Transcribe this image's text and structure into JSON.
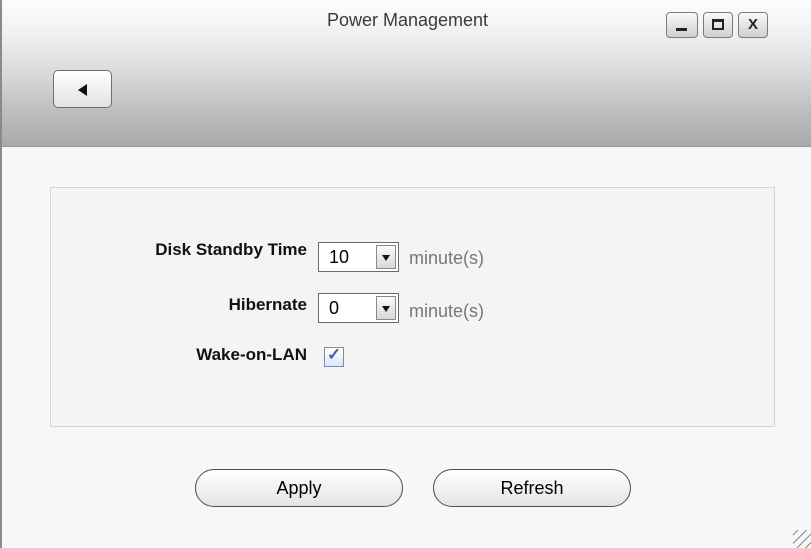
{
  "window": {
    "title": "Power Management",
    "controls": [
      "minimize-icon",
      "maximize-icon",
      "close-icon"
    ],
    "close_glyph": "X"
  },
  "toolbar": {
    "back_icon": "left-arrow-icon"
  },
  "form": {
    "disk_standby": {
      "label": "Disk Standby Time",
      "value": "10",
      "unit": "minute(s)"
    },
    "hibernate": {
      "label": "Hibernate",
      "value": "0",
      "unit": "minute(s)"
    },
    "wake_on_lan": {
      "label": "Wake-on-LAN",
      "checked": true,
      "check_glyph": "✓"
    }
  },
  "actions": {
    "apply_label": "Apply",
    "refresh_label": "Refresh"
  },
  "colors": {
    "titlebar_bottom": "#a9a9a9",
    "checkbox_mark": "#4a62a8"
  }
}
